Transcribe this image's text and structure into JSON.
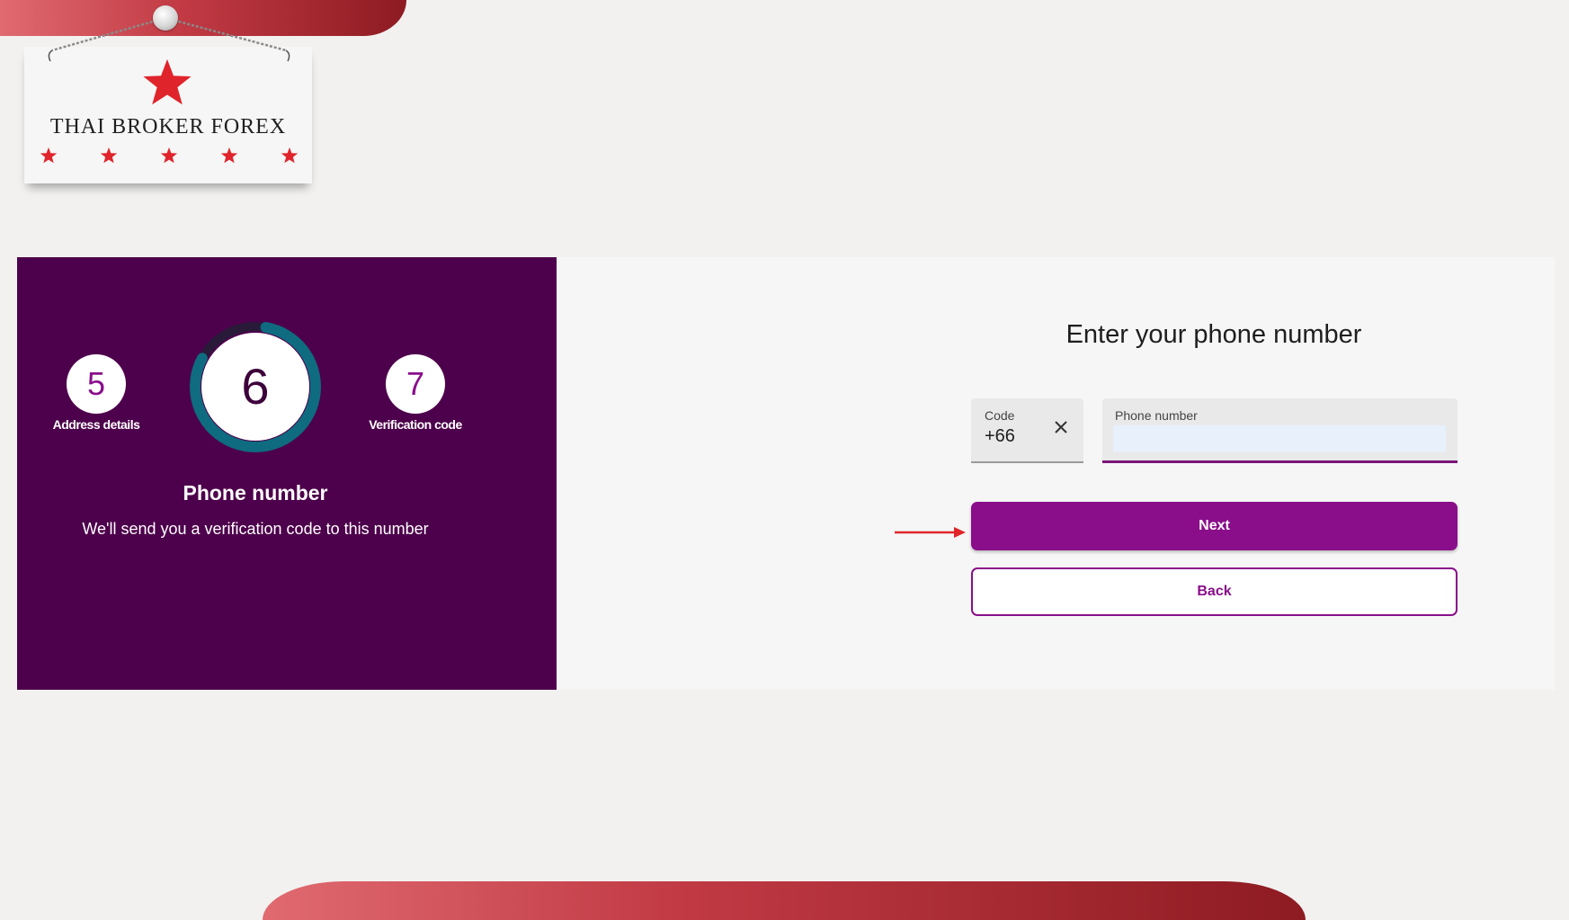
{
  "brand": {
    "name": "THAI BROKER FOREX",
    "accent_color": "#e0242b"
  },
  "progress": {
    "previous_step": {
      "number": "5",
      "label": "Address details"
    },
    "current_step": {
      "number": "6",
      "title": "Phone number",
      "subtitle": "We'll send you a verification code to this number",
      "ring_progress": 0.8
    },
    "next_step": {
      "number": "7",
      "label": "Verification code"
    },
    "panel_color": "#4d004b",
    "ring_color": "#0e6b80"
  },
  "form": {
    "title": "Enter your phone number",
    "code_field": {
      "label": "Code",
      "value": "+66",
      "clear_icon": "close-icon"
    },
    "phone_field": {
      "label": "Phone number",
      "value": ""
    },
    "next_label": "Next",
    "back_label": "Back",
    "primary_color": "#8a0e8a",
    "annotation_arrow_color": "#e0242b"
  }
}
